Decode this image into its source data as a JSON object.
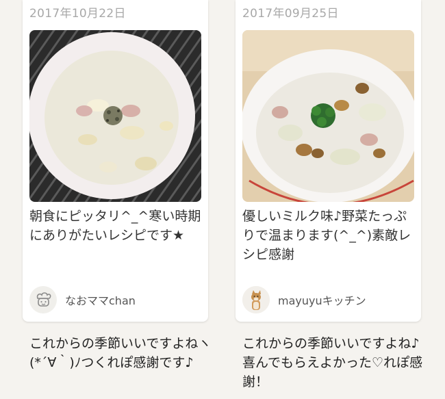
{
  "cards": [
    {
      "date": "2017年10月22日",
      "title": "朝食にピッタリ^_^寒い時期にありがたいレシピです★",
      "author": "なおママchan",
      "avatar_icon": "chef-face-icon",
      "comment": "これからの季節いいですよねヽ(*´∀｀)ﾉつくれぽ感謝です♪"
    },
    {
      "date": "2017年09月25日",
      "title": "優しいミルク味♪野菜たっぷりで温まります(^_^)素敵レシピ感謝",
      "author": "mayuyuキッチン",
      "avatar_icon": "dog-photo-icon",
      "comment": "これからの季節いいですよね♪喜んでもらえよかった♡れぽ感謝！"
    }
  ]
}
